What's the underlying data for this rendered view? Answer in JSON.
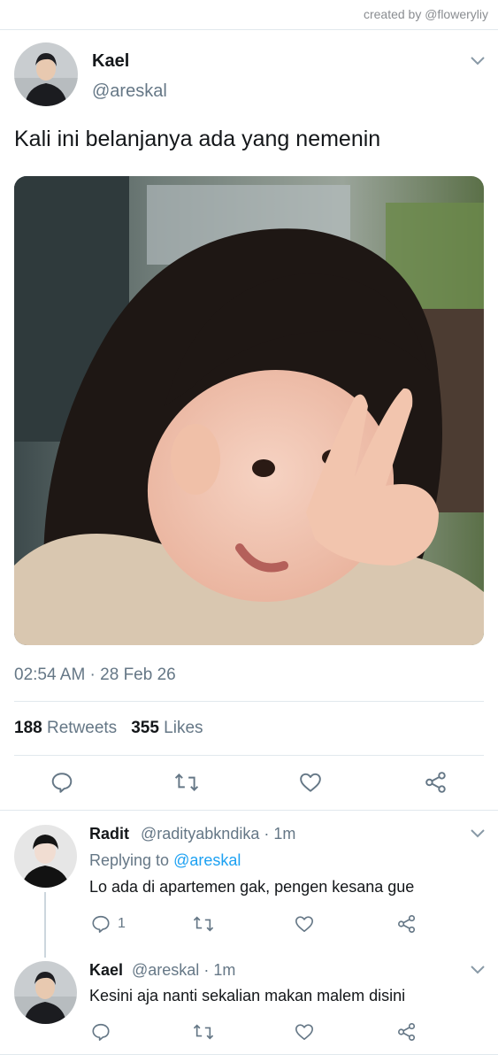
{
  "credit": "created by @floweryliy",
  "main_tweet": {
    "name": "Kael",
    "handle": "@areskal",
    "text": "Kali ini belanjanya ada yang nemenin",
    "timestamp": "02:54 AM · 28 Feb 26",
    "retweets_count": "188",
    "retweets_label": "Retweets",
    "likes_count": "355",
    "likes_label": "Likes"
  },
  "replies": [
    {
      "name": "Radit",
      "handle": "@radityabkndika",
      "time": "· 1m",
      "replying_prefix": "Replying to",
      "replying_to": "@areskal",
      "text": "Lo ada di apartemen gak, pengen kesana gue",
      "reply_count": "1"
    },
    {
      "name": "Kael",
      "handle": "@areskal",
      "time": "· 1m",
      "text": "Kesini aja nanti sekalian makan malem disini",
      "reply_count": ""
    }
  ],
  "icons": {
    "reply": "reply-icon",
    "retweet": "retweet-icon",
    "like": "heart-icon",
    "share": "share-icon",
    "menu": "chevron-down-icon"
  },
  "colors": {
    "link": "#1da1f2",
    "secondary_text": "#657786",
    "divider": "#e1e8ed"
  }
}
